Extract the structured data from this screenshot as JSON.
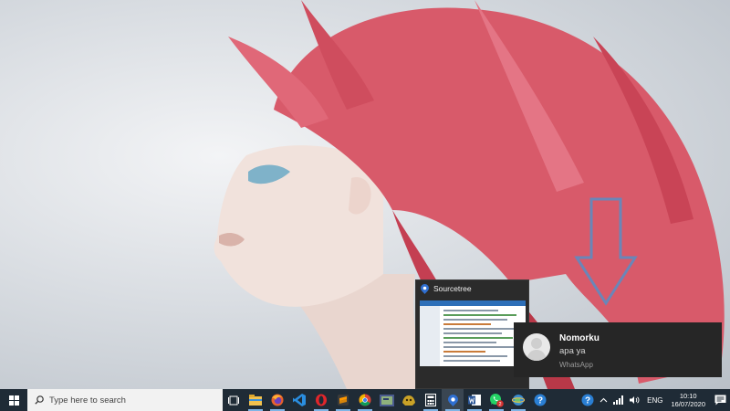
{
  "taskbar": {
    "search_placeholder": "Type here to search",
    "apps": [
      {
        "name": "task-view-icon"
      },
      {
        "name": "file-explorer-icon"
      },
      {
        "name": "firefox-icon"
      },
      {
        "name": "vscode-icon"
      },
      {
        "name": "opera-icon"
      },
      {
        "name": "sublime-text-icon"
      },
      {
        "name": "chrome-icon"
      },
      {
        "name": "terminal-app-icon"
      },
      {
        "name": "game-app-icon"
      },
      {
        "name": "calculator-icon"
      },
      {
        "name": "sourcetree-icon"
      },
      {
        "name": "word-icon"
      },
      {
        "name": "whatsapp-icon",
        "badge": "2"
      },
      {
        "name": "globe-app-icon"
      },
      {
        "name": "help-icon"
      }
    ],
    "tray": {
      "language": "ENG",
      "time": "10:10",
      "date": "16/07/2020"
    }
  },
  "preview": {
    "title": "Sourcetree"
  },
  "notification": {
    "sender": "Nomorku",
    "message": "apa ya",
    "app": "WhatsApp"
  },
  "colors": {
    "taskbar_bg": "#1f2b36",
    "toast_bg": "#262626",
    "arrow_blue": "#6a86b8",
    "arrow_red": "#8b1212",
    "accent": "#7fb5e6"
  }
}
